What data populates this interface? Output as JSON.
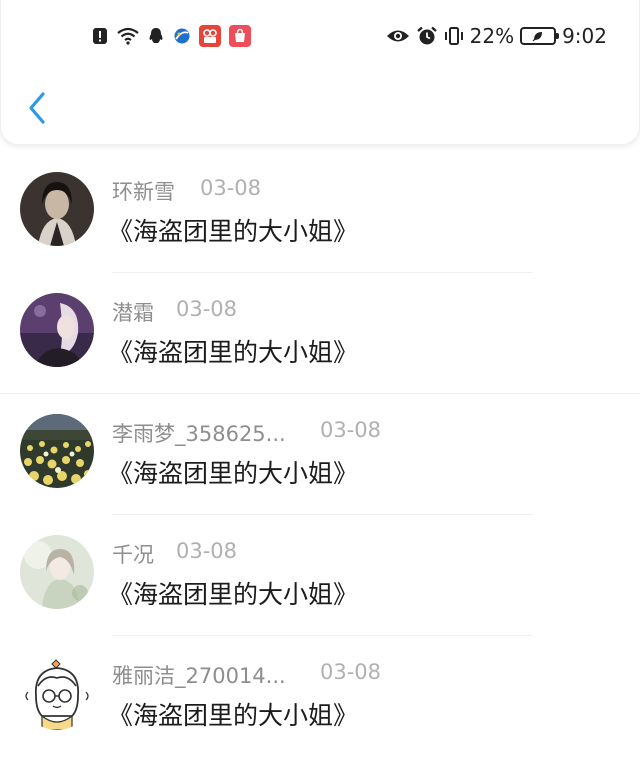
{
  "status_bar": {
    "battery_percent": "22%",
    "time": "9:02"
  },
  "header": {
    "back_icon": "chevron-left-icon",
    "accent_color": "#2a9ae8"
  },
  "items": [
    {
      "name": "环新雪",
      "date": "03-08",
      "title": "《海盗团里的大小姐》"
    },
    {
      "name": "潜霜",
      "date": "03-08",
      "title": "《海盗团里的大小姐》"
    },
    {
      "name": "李雨梦_358625...",
      "date": "03-08",
      "title": "《海盗团里的大小姐》"
    },
    {
      "name": "千况",
      "date": "03-08",
      "title": "《海盗团里的大小姐》"
    },
    {
      "name": "雅丽洁_270014...",
      "date": "03-08",
      "title": "《海盗团里的大小姐》"
    }
  ]
}
